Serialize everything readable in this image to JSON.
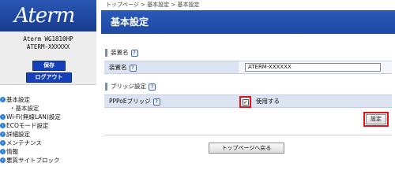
{
  "sidebar": {
    "logo": "Aterm",
    "device_model": "Aterm WG1810HP",
    "device_name": "ATERM-XXXXXX",
    "save_label": "保存",
    "logout_label": "ログアウト",
    "nav": [
      {
        "label": "基本設定",
        "icon": "circle-arrow-icon"
      },
      {
        "label": "Wi-Fi(無線LAN)設定",
        "icon": "circle-arrow-icon"
      },
      {
        "label": "ECOモード設定",
        "icon": "circle-arrow-icon"
      },
      {
        "label": "詳細設定",
        "icon": "circle-arrow-icon"
      },
      {
        "label": "メンテナンス",
        "icon": "circle-arrow-icon"
      },
      {
        "label": "情報",
        "icon": "circle-arrow-icon"
      },
      {
        "label": "悪質サイトブロック",
        "icon": "circle-arrow-icon"
      }
    ],
    "nav_sub": "基本設定"
  },
  "main": {
    "breadcrumb": "トップページ > 基本設定 > 基本設定",
    "title": "基本設定",
    "section1": {
      "title": "装置名",
      "help": "?"
    },
    "device_name_label": "装置名",
    "device_name_help": "?",
    "device_name_value": "ATERM-XXXXXX",
    "section2": {
      "title": "ブリッジ設定",
      "help": "?"
    },
    "pppoe_label": "PPPoEブリッジ",
    "pppoe_help": "?",
    "pppoe_checked": "✓",
    "pppoe_option": "使用する",
    "set_button": "設定",
    "back_button": "トップページへ戻る"
  },
  "colors": {
    "header_blue": "#1c4aa4",
    "highlight_red": "#e0141b",
    "row_blue": "#dce3f2"
  }
}
